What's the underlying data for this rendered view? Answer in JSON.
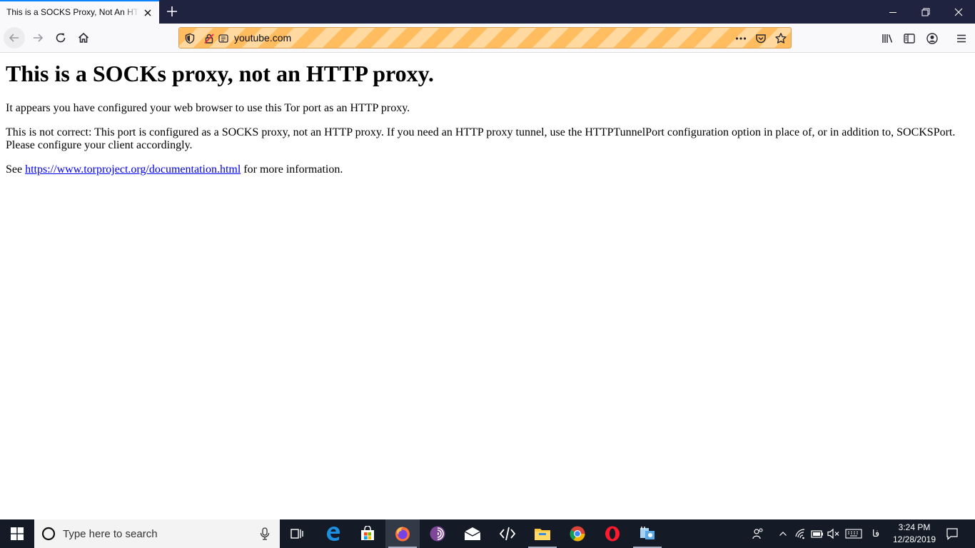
{
  "browser": {
    "tab_title": "This is a SOCKS Proxy, Not An HTTP Proxy",
    "url": "youtube.com"
  },
  "page": {
    "heading": "This is a SOCKs proxy, not an HTTP proxy.",
    "para1": "It appears you have configured your web browser to use this Tor port as an HTTP proxy.",
    "para2": "This is not correct: This port is configured as a SOCKS proxy, not an HTTP proxy. If you need an HTTP proxy tunnel, use the HTTPTunnelPort configuration option in place of, or in addition to, SOCKSPort. Please configure your client accordingly.",
    "para3_prefix": "See ",
    "link": "https://www.torproject.org/documentation.html",
    "para3_suffix": " for more information."
  },
  "taskbar": {
    "search_placeholder": "Type here to search",
    "time": "3:24 PM",
    "date": "12/28/2019",
    "language": "فا"
  },
  "colors": {
    "titlebar": "#202340",
    "accent": "#0a84ff",
    "urlbar_stripe_a": "#ffbd60",
    "urlbar_stripe_b": "#ffd9a0",
    "taskbar": "#141b26",
    "link": "#0000ee"
  }
}
